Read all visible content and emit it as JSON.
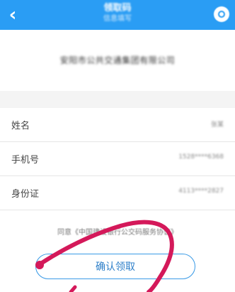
{
  "header": {
    "back_glyph": "‹",
    "title": "领取码",
    "subtitle": "信息填写",
    "background_color": "#2a9df4",
    "menu_icon": "menu-circle-icon"
  },
  "company": {
    "name": "安阳市公共交通集团有限公司"
  },
  "form": {
    "rows": [
      {
        "label": "姓名",
        "value": "张某"
      },
      {
        "label": "手机号",
        "value": "1528****6368"
      },
      {
        "label": "身份证",
        "value": "4113****2827"
      }
    ]
  },
  "agreement": {
    "text": "同意《中国建设银行公交码服务协议》"
  },
  "confirm": {
    "label": "确认领取",
    "accent_color": "#3a9ae6"
  },
  "annotation": {
    "stroke_color": "#d4195a"
  }
}
